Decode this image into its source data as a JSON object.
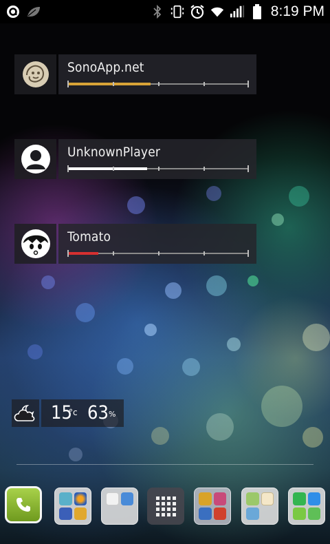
{
  "status_bar": {
    "time": "8:19 PM",
    "left_icons": [
      "app-notification-icon",
      "leaf-icon"
    ],
    "right_icons": [
      "bluetooth-icon",
      "vibrate-icon",
      "alarm-icon",
      "wifi-icon",
      "signal-icon",
      "battery-icon"
    ]
  },
  "players": [
    {
      "name": "SonoApp.net",
      "progress": 0.46,
      "fill_color": "#d9a437",
      "avatar": "sono-avatar-icon"
    },
    {
      "name": "UnknownPlayer",
      "progress": 0.44,
      "fill_color": "#ffffff",
      "avatar": "person-avatar-icon"
    },
    {
      "name": "Tomato",
      "progress": 0.17,
      "fill_color": "#d63030",
      "avatar": "tomato-avatar-icon"
    }
  ],
  "weather": {
    "icon": "cloudy-night-icon",
    "temperature": "15",
    "unit": "°c",
    "humidity": "63",
    "humidity_unit": "%"
  },
  "dock": {
    "items": [
      "phone-icon",
      "folder-social",
      "folder-media",
      "apps-drawer-icon",
      "folder-games",
      "folder-tools",
      "folder-messaging"
    ]
  }
}
